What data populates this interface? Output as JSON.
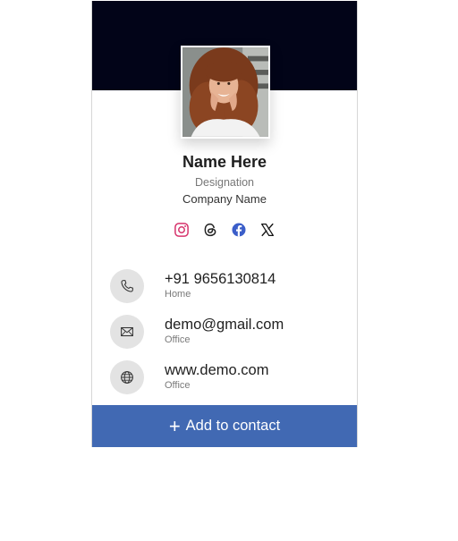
{
  "profile": {
    "name": "Name Here",
    "designation": "Designation",
    "company": "Company Name"
  },
  "colors": {
    "cover": "#020418",
    "button": "#4169b3",
    "icon_bg": "#e3e3e3",
    "instagram": "#d6336c",
    "facebook": "#3b5ec9"
  },
  "socials": [
    {
      "name": "instagram-icon"
    },
    {
      "name": "threads-icon"
    },
    {
      "name": "facebook-icon"
    },
    {
      "name": "x-icon"
    }
  ],
  "contacts": [
    {
      "icon": "phone-icon",
      "value": "+91 9656130814",
      "label": "Home"
    },
    {
      "icon": "mail-icon",
      "value": "demo@gmail.com",
      "label": "Office"
    },
    {
      "icon": "globe-icon",
      "value": "www.demo.com",
      "label": "Office"
    }
  ],
  "button": {
    "icon": "plus-icon",
    "label": "Add to contact"
  }
}
